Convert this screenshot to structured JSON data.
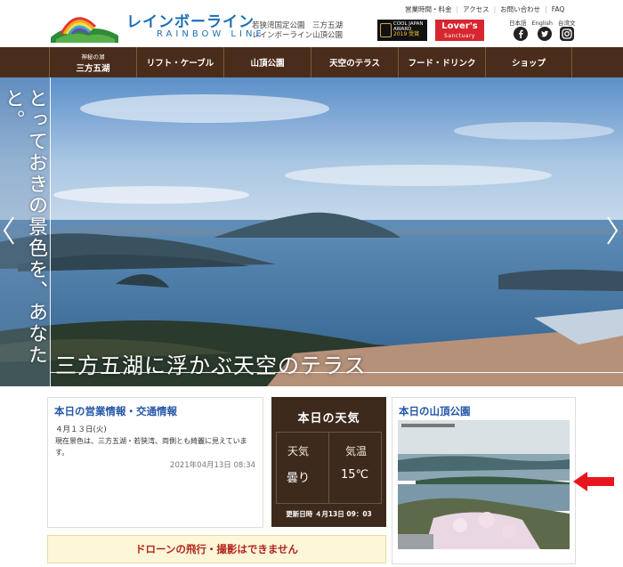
{
  "header": {
    "brand_jp": "レインボーライン",
    "brand_en": "RAINBOW LINE",
    "park_line1": "若狭湾国定公園　三方五湖",
    "park_line2": "レインボーライン山頂公園",
    "award": {
      "line1": "COOL JAPAN",
      "line2": "AWARD",
      "line3": "2019 受賞"
    },
    "lovers": {
      "main": "Lover's",
      "sub": "Sanctuary"
    },
    "top_links": [
      "営業時間・料金",
      "アクセス",
      "お問い合わせ",
      "FAQ"
    ],
    "languages": [
      "日本語",
      "English",
      "台湾文"
    ],
    "social": [
      "facebook-icon",
      "twitter-icon",
      "instagram-icon"
    ]
  },
  "nav": {
    "items": [
      {
        "small": "神秘の湖",
        "label": "三方五湖"
      },
      {
        "small": "",
        "label": "リフト・ケーブル"
      },
      {
        "small": "",
        "label": "山頂公園"
      },
      {
        "small": "",
        "label": "天空のテラス"
      },
      {
        "small": "",
        "label": "フード・ドリンク"
      },
      {
        "small": "",
        "label": "ショップ"
      }
    ]
  },
  "hero": {
    "vertical_text": "とっておきの景色を、あなたと。",
    "caption": "三方五湖に浮かぶ天空のテラス"
  },
  "operations": {
    "title": "本日の営業情報・交通情報",
    "date": "４月１３日(火)",
    "body": "現在景色は、三方五湖・若狭湾、両側とも綺麗に見えています。",
    "timestamp": "2021年04月13日 08:34"
  },
  "weather": {
    "title": "本日の天気",
    "weather_label": "天気",
    "weather_value": "曇り",
    "temp_label": "気温",
    "temp_value": "15℃",
    "updated": "更新日時 ４月13日 09：03"
  },
  "summit": {
    "title": "本日の山頂公園"
  },
  "notice": {
    "drone": "ドローンの飛行・撮影はできません"
  },
  "colors": {
    "nav_bg": "#4a2c1a",
    "accent_blue": "#2557a7",
    "brand_blue": "#1d6fb5",
    "notice_red": "#b3261e",
    "weather_bg": "#3d2a1c"
  }
}
